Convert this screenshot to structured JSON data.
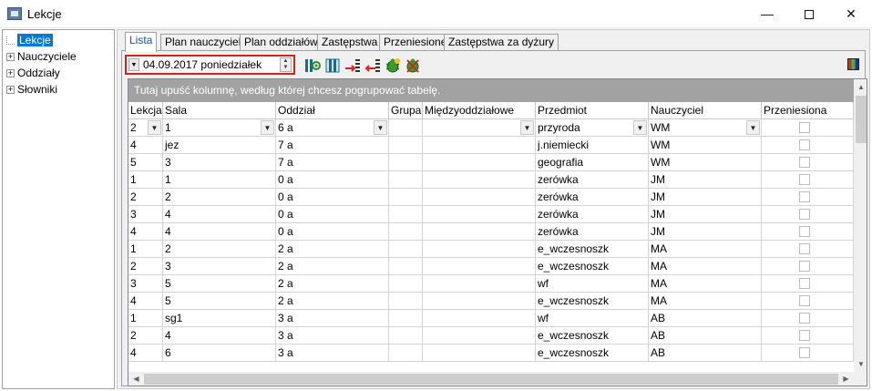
{
  "window": {
    "title": "Lekcje",
    "minimize": "—",
    "close": "✕"
  },
  "tree": {
    "items": [
      {
        "label": "Lekcje",
        "selected": true
      },
      {
        "label": "Nauczyciele"
      },
      {
        "label": "Oddziały"
      },
      {
        "label": "Słowniki"
      }
    ]
  },
  "tabs": [
    "Lista",
    "Plan nauczycieli",
    "Plan oddziałów",
    "Zastępstwa",
    "Przeniesione",
    "Zastępstwa za dyżury"
  ],
  "toolbar": {
    "date_value": "04.09.2017 poniedziałek"
  },
  "grid": {
    "group_hint": "Tutaj upuść kolumnę, według której chcesz pogrupować tabelę.",
    "columns": [
      "Lekcja",
      "Sala",
      "Oddział",
      "Grupa",
      "Międzyoddziałowe",
      "Przedmiot",
      "Nauczyciel",
      "Przeniesiona"
    ],
    "filter": {
      "lekcja": "2",
      "sala": "1",
      "oddzial": "6 a",
      "grupa": "",
      "miedzy": "",
      "przedmiot": "przyroda",
      "nauczyciel": "WM"
    },
    "rows": [
      {
        "lekcja": "4",
        "sala": "jez",
        "oddzial": "7 a",
        "grupa": "",
        "miedzy": "",
        "przedmiot": "j.niemiecki",
        "nauczyciel": "WM"
      },
      {
        "lekcja": "5",
        "sala": "3",
        "oddzial": "7 a",
        "grupa": "",
        "miedzy": "",
        "przedmiot": "geografia",
        "nauczyciel": "WM"
      },
      {
        "lekcja": "1",
        "sala": "1",
        "oddzial": "0 a",
        "grupa": "",
        "miedzy": "",
        "przedmiot": "zerówka",
        "nauczyciel": "JM"
      },
      {
        "lekcja": "2",
        "sala": "2",
        "oddzial": "0 a",
        "grupa": "",
        "miedzy": "",
        "przedmiot": "zerówka",
        "nauczyciel": "JM"
      },
      {
        "lekcja": "3",
        "sala": "4",
        "oddzial": "0 a",
        "grupa": "",
        "miedzy": "",
        "przedmiot": "zerówka",
        "nauczyciel": "JM"
      },
      {
        "lekcja": "4",
        "sala": "4",
        "oddzial": "0 a",
        "grupa": "",
        "miedzy": "",
        "przedmiot": "zerówka",
        "nauczyciel": "JM"
      },
      {
        "lekcja": "1",
        "sala": "2",
        "oddzial": "2 a",
        "grupa": "",
        "miedzy": "",
        "przedmiot": "e_wczesnoszk",
        "nauczyciel": "MA"
      },
      {
        "lekcja": "2",
        "sala": "3",
        "oddzial": "2 a",
        "grupa": "",
        "miedzy": "",
        "przedmiot": "e_wczesnoszk",
        "nauczyciel": "MA"
      },
      {
        "lekcja": "3",
        "sala": "5",
        "oddzial": "2 a",
        "grupa": "",
        "miedzy": "",
        "przedmiot": "wf",
        "nauczyciel": "MA"
      },
      {
        "lekcja": "4",
        "sala": "5",
        "oddzial": "2 a",
        "grupa": "",
        "miedzy": "",
        "przedmiot": "e_wczesnoszk",
        "nauczyciel": "MA"
      },
      {
        "lekcja": "1",
        "sala": "sg1",
        "oddzial": "3 a",
        "grupa": "",
        "miedzy": "",
        "przedmiot": "wf",
        "nauczyciel": "AB"
      },
      {
        "lekcja": "2",
        "sala": "4",
        "oddzial": "3 a",
        "grupa": "",
        "miedzy": "",
        "przedmiot": "e_wczesnoszk",
        "nauczyciel": "AB"
      },
      {
        "lekcja": "4",
        "sala": "6",
        "oddzial": "3 a",
        "grupa": "",
        "miedzy": "",
        "przedmiot": "e_wczesnoszk",
        "nauczyciel": "AB"
      }
    ]
  }
}
